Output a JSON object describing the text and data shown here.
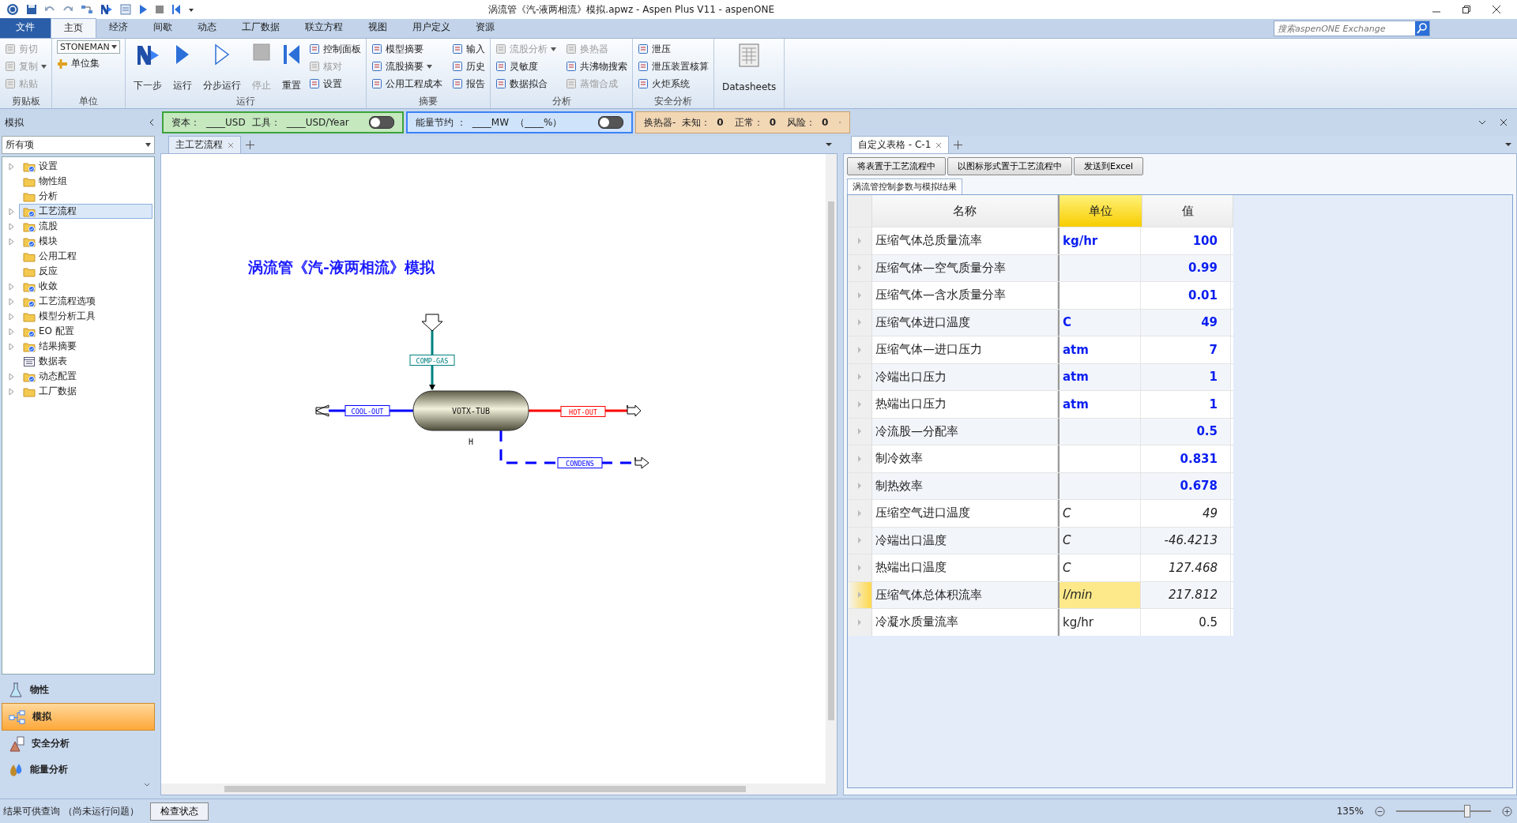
{
  "title": "涡流管《汽-液两相流》模拟.apwz - Aspen Plus V11 - aspenONE",
  "menu_tabs": [
    {
      "label": "文件",
      "kind": "file",
      "selected": false
    },
    {
      "label": "主页",
      "kind": "tab",
      "selected": true
    },
    {
      "label": "经济",
      "kind": "tab",
      "selected": false
    },
    {
      "label": "间歇",
      "kind": "tab",
      "selected": false
    },
    {
      "label": "动态",
      "kind": "tab",
      "selected": false
    },
    {
      "label": "工厂数据",
      "kind": "tab",
      "selected": false
    },
    {
      "label": "联立方程",
      "kind": "tab",
      "selected": false
    },
    {
      "label": "视图",
      "kind": "tab",
      "selected": false
    },
    {
      "label": "用户定义",
      "kind": "tab",
      "selected": false
    },
    {
      "label": "资源",
      "kind": "tab",
      "selected": false
    }
  ],
  "search": {
    "placeholder": "搜索aspenONE Exchange"
  },
  "ribbon": [
    {
      "label": "剪贴板",
      "items": [
        {
          "label": "剪切",
          "disabled": true,
          "dropdown": false
        },
        {
          "label": "复制",
          "disabled": true,
          "dropdown": true
        },
        {
          "label": "粘贴",
          "disabled": true,
          "dropdown": false
        }
      ]
    },
    {
      "label": "单位",
      "combo": "STONEMAN",
      "items": [
        {
          "label": "单位集",
          "disabled": false,
          "dropdown": false
        }
      ]
    },
    {
      "label": "运行",
      "large": [
        {
          "label": "下一步",
          "disabled": false
        },
        {
          "label": "运行",
          "disabled": false
        },
        {
          "label": "分步运行",
          "disabled": false
        },
        {
          "label": "停止",
          "disabled": true
        },
        {
          "label": "重置",
          "disabled": false
        }
      ],
      "items": [
        {
          "label": "控制面板",
          "disabled": false,
          "dropdown": false
        },
        {
          "label": "核对",
          "disabled": true,
          "dropdown": false
        },
        {
          "label": "设置",
          "disabled": false,
          "dropdown": false
        }
      ]
    },
    {
      "label": "摘要",
      "items": [
        {
          "label": "模型摘要",
          "disabled": false,
          "dropdown": false
        },
        {
          "label": "流股摘要",
          "disabled": false,
          "dropdown": true
        },
        {
          "label": "公用工程成本",
          "disabled": false,
          "dropdown": false
        },
        {
          "label": "输入",
          "disabled": false,
          "dropdown": false
        },
        {
          "label": "历史",
          "disabled": false,
          "dropdown": false
        },
        {
          "label": "报告",
          "disabled": false,
          "dropdown": false
        }
      ]
    },
    {
      "label": "分析",
      "items": [
        {
          "label": "流股分析",
          "disabled": true,
          "dropdown": true
        },
        {
          "label": "灵敏度",
          "disabled": false,
          "dropdown": false
        },
        {
          "label": "数据拟合",
          "disabled": false,
          "dropdown": false
        },
        {
          "label": "换热器",
          "disabled": true,
          "dropdown": false
        },
        {
          "label": "共沸物搜索",
          "disabled": false,
          "dropdown": false
        },
        {
          "label": "蒸馏合成",
          "disabled": true,
          "dropdown": false
        }
      ]
    },
    {
      "label": "安全分析",
      "items": [
        {
          "label": "泄压",
          "disabled": false,
          "dropdown": false
        },
        {
          "label": "泄压装置核算",
          "disabled": false,
          "dropdown": false
        },
        {
          "label": "火炬系统",
          "disabled": false,
          "dropdown": false
        }
      ]
    },
    {
      "large": [
        {
          "label": "Datasheets",
          "disabled": false
        }
      ]
    }
  ],
  "sidebar": {
    "title": "模拟",
    "filter": "所有项",
    "items": [
      {
        "label": "设置",
        "expandable": true,
        "checked": true,
        "kind": "folder",
        "selected": false
      },
      {
        "label": "物性组",
        "expandable": false,
        "checked": false,
        "kind": "folder",
        "selected": false
      },
      {
        "label": "分析",
        "expandable": false,
        "checked": false,
        "kind": "folder",
        "selected": false
      },
      {
        "label": "工艺流程",
        "expandable": true,
        "checked": true,
        "kind": "folder",
        "selected": true
      },
      {
        "label": "流股",
        "expandable": true,
        "checked": true,
        "kind": "folder",
        "selected": false
      },
      {
        "label": "模块",
        "expandable": true,
        "checked": true,
        "kind": "folder",
        "selected": false
      },
      {
        "label": "公用工程",
        "expandable": false,
        "checked": false,
        "kind": "folder",
        "selected": false
      },
      {
        "label": "反应",
        "expandable": false,
        "checked": false,
        "kind": "folder",
        "selected": false
      },
      {
        "label": "收敛",
        "expandable": true,
        "checked": true,
        "kind": "folder",
        "selected": false
      },
      {
        "label": "工艺流程选项",
        "expandable": true,
        "checked": true,
        "kind": "folder",
        "selected": false
      },
      {
        "label": "模型分析工具",
        "expandable": true,
        "checked": false,
        "kind": "folder",
        "selected": false
      },
      {
        "label": "EO 配置",
        "expandable": true,
        "checked": true,
        "kind": "folder",
        "selected": false
      },
      {
        "label": "结果摘要",
        "expandable": true,
        "checked": true,
        "kind": "folder",
        "selected": false
      },
      {
        "label": "数据表",
        "expandable": false,
        "checked": false,
        "kind": "table",
        "selected": false
      },
      {
        "label": "动态配置",
        "expandable": true,
        "checked": true,
        "kind": "folder",
        "selected": false
      },
      {
        "label": "工厂数据",
        "expandable": true,
        "checked": false,
        "kind": "folder",
        "selected": false
      }
    ],
    "nav": [
      {
        "label": "物性",
        "selected": false
      },
      {
        "label": "模拟",
        "selected": true
      },
      {
        "label": "安全分析",
        "selected": false
      },
      {
        "label": "能量分析",
        "selected": false
      }
    ]
  },
  "cost_panel": {
    "texts": [
      "资本：",
      "____USD",
      "工具：",
      "____USD/Year"
    ],
    "on": false
  },
  "energy_panel": {
    "texts": [
      "能量节约 ：",
      "____MW",
      "（____%）"
    ],
    "on": false
  },
  "hx_panel": {
    "texts": [
      "换热器-",
      "未知：",
      "0",
      "正常：",
      "0",
      "风险：",
      "0"
    ]
  },
  "flowsheet": {
    "tab": "主工艺流程",
    "title": "涡流管《汽-液两相流》模拟",
    "block": {
      "name": "VOTX-TUB",
      "label": "H"
    },
    "streams": [
      {
        "name": "COMP-GAS",
        "color": "#008080",
        "dashed": false
      },
      {
        "name": "COOL-OUT",
        "color": "#0000ff",
        "dashed": false
      },
      {
        "name": "HOT-OUT",
        "color": "#ff0000",
        "dashed": false
      },
      {
        "name": "CONDENS",
        "color": "#0000ff",
        "dashed": true
      }
    ]
  },
  "table_panel": {
    "tab": "自定义表格 - C-1",
    "buttons": [
      "将表置于工艺流程中",
      "以图标形式置于工艺流程中",
      "发送到Excel"
    ],
    "sheet_tab": "涡流管控制参数与模拟结果",
    "columns": [
      {
        "label": "名称",
        "selected": false
      },
      {
        "label": "单位",
        "selected": true
      },
      {
        "label": "值",
        "selected": false
      }
    ],
    "rows": [
      {
        "name": "压缩气体总质量流率",
        "unit": "kg/hr",
        "value": "100",
        "kind": "input",
        "selected": false
      },
      {
        "name": "压缩气体—空气质量分率",
        "unit": "",
        "value": "0.99",
        "kind": "input",
        "selected": false
      },
      {
        "name": "压缩气体—含水质量分率",
        "unit": "",
        "value": "0.01",
        "kind": "input",
        "selected": false
      },
      {
        "name": "压缩气体进口温度",
        "unit": "C",
        "value": "49",
        "kind": "input",
        "selected": false
      },
      {
        "name": "压缩气体—进口压力",
        "unit": "atm",
        "value": "7",
        "kind": "input",
        "selected": false
      },
      {
        "name": "冷端出口压力",
        "unit": "atm",
        "value": "1",
        "kind": "input",
        "selected": false
      },
      {
        "name": "热端出口压力",
        "unit": "atm",
        "value": "1",
        "kind": "input",
        "selected": false
      },
      {
        "name": "冷流股—分配率",
        "unit": "",
        "value": "0.5",
        "kind": "input",
        "selected": false
      },
      {
        "name": "制冷效率",
        "unit": "",
        "value": "0.831",
        "kind": "input",
        "selected": false
      },
      {
        "name": "制热效率",
        "unit": "",
        "value": "0.678",
        "kind": "input",
        "selected": false
      },
      {
        "name": "压缩空气进口温度",
        "unit": "C",
        "value": "49",
        "kind": "result",
        "selected": false
      },
      {
        "name": "冷端出口温度",
        "unit": "C",
        "value": "-46.4213",
        "kind": "result",
        "selected": false
      },
      {
        "name": "热端出口温度",
        "unit": "C",
        "value": "127.468",
        "kind": "result",
        "selected": false
      },
      {
        "name": "压缩气体总体积流率",
        "unit": "l/min",
        "value": "217.812",
        "kind": "result",
        "selected": true
      },
      {
        "name": "冷凝水质量流率",
        "unit": "kg/hr",
        "value": "0.5",
        "kind": "plain",
        "selected": false
      }
    ]
  },
  "status_bar": {
    "message": "结果可供查询 （尚未运行问题）",
    "button": "检查状态",
    "zoom": "135%",
    "level": 0.75
  }
}
